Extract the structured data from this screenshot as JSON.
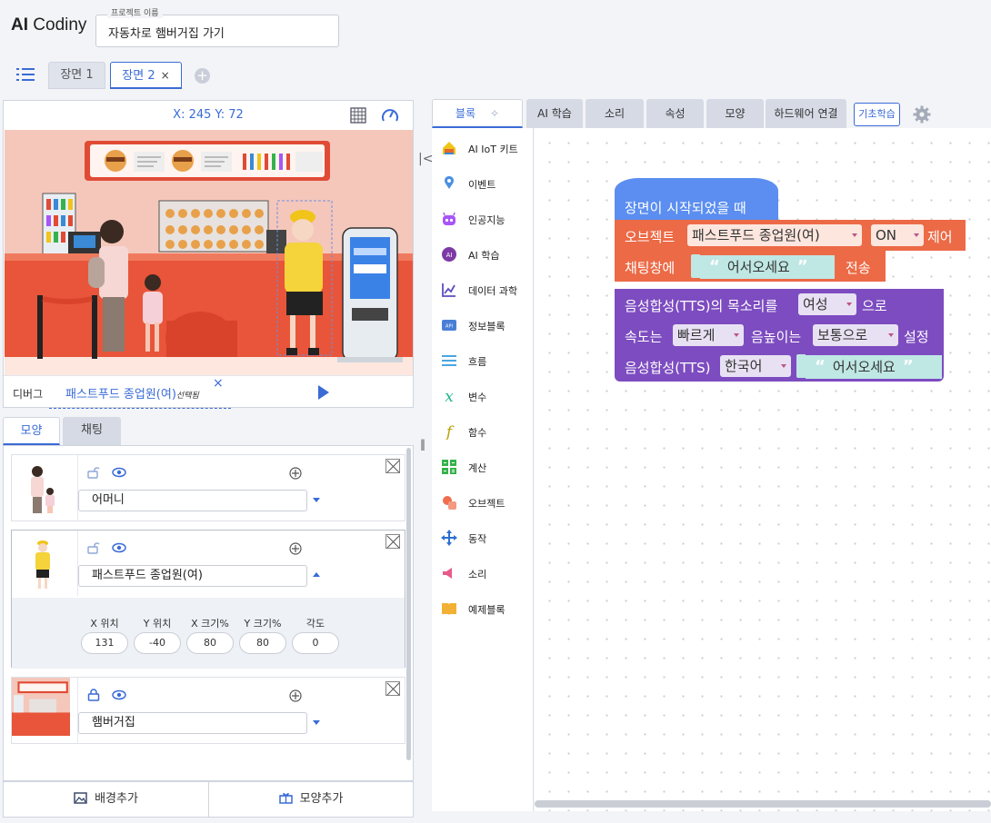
{
  "app": {
    "logo_ai": "AI",
    "logo_rest": " Codiny"
  },
  "project": {
    "label": "프로젝트 이름",
    "name": "자동차로 햄버거집 가기"
  },
  "scenes": [
    {
      "label": "장면 1"
    },
    {
      "label": "장면 2",
      "close": "×"
    }
  ],
  "stage": {
    "coords": "X: 245 Y: 72",
    "debug_label": "디버그",
    "selected_object": "패스트푸드 종업원(여)",
    "selected_suffix": "선택됨",
    "close": "×"
  },
  "left_tabs": {
    "shape": "모양",
    "chat": "채팅"
  },
  "objects": [
    {
      "name": "어머니"
    },
    {
      "name": "패스트푸드 종업원(여)",
      "props": [
        {
          "label": "X 위치",
          "value": "131"
        },
        {
          "label": "Y 위치",
          "value": "-40"
        },
        {
          "label": "X 크기%",
          "value": "80"
        },
        {
          "label": "Y 크기%",
          "value": "80"
        },
        {
          "label": "각도",
          "value": "0"
        }
      ]
    },
    {
      "name": "햄버거집"
    }
  ],
  "bottom_buttons": {
    "add_bg": "배경추가",
    "add_shape": "모양추가"
  },
  "block_tabs": [
    "블록",
    "AI 학습",
    "소리",
    "속성",
    "모양",
    "하드웨어 연결"
  ],
  "basic_learning": "기초학습",
  "categories": [
    {
      "label": "AI IoT 키트",
      "icon": "house-icon",
      "color": "#f0c419"
    },
    {
      "label": "이벤트",
      "icon": "pin-icon",
      "color": "#4a90e2"
    },
    {
      "label": "인공지능",
      "icon": "robot-icon",
      "color": "#a855f7"
    },
    {
      "label": "AI 학습",
      "icon": "ai-icon",
      "color": "#7d3aa6"
    },
    {
      "label": "데이터 과학",
      "icon": "chart-icon",
      "color": "#5b4cc0"
    },
    {
      "label": "정보블록",
      "icon": "api-icon",
      "color": "#4a7fd6"
    },
    {
      "label": "흐름",
      "icon": "flow-icon",
      "color": "#4aa6e0"
    },
    {
      "label": "변수",
      "icon": "variable-icon",
      "color": "#1fb58a"
    },
    {
      "label": "함수",
      "icon": "function-icon",
      "color": "#b8a10a"
    },
    {
      "label": "계산",
      "icon": "calc-icon",
      "color": "#35b24b"
    },
    {
      "label": "오브젝트",
      "icon": "object-icon",
      "color": "#ef6e4f"
    },
    {
      "label": "동작",
      "icon": "move-icon",
      "color": "#2d6fd1"
    },
    {
      "label": "소리",
      "icon": "speaker-icon",
      "color": "#e85a8b"
    },
    {
      "label": "예제블록",
      "icon": "book-icon",
      "color": "#f2b134"
    }
  ],
  "blocks": {
    "hat": "장면이 시작되었을 때",
    "obj_prefix": "오브젝트",
    "obj_dd": "패스트푸드 종업원(여)",
    "obj_state": "ON",
    "obj_suffix": "제어",
    "chat_prefix": "채팅창에",
    "chat_text": "어서오세요",
    "chat_suffix": "전송",
    "voice_prefix": "음성합성(TTS)의 목소리를",
    "voice_dd": "여성",
    "voice_suffix": "으로",
    "speed_prefix": "속도는",
    "speed_dd": "빠르게",
    "pitch_prefix": "음높이는",
    "pitch_dd": "보통으로",
    "pitch_suffix": "설정",
    "tts_prefix": "음성합성(TTS)",
    "tts_lang": "한국어",
    "tts_text": "어서오세요",
    "open_quote": "“",
    "close_quote": "”"
  },
  "colors": {
    "accent": "#3a6bd6",
    "hat": "#5b8ef0",
    "orange": "#ec6a46",
    "purple": "#7d4cc0",
    "string": "#bfe7e4"
  }
}
